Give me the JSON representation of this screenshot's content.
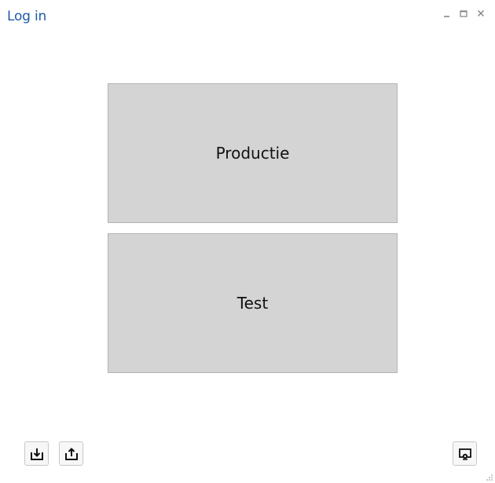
{
  "window": {
    "title": "Log in",
    "controls": {
      "minimize": "_",
      "maximize": "□",
      "close": "×"
    }
  },
  "environments": [
    {
      "label": "Productie"
    },
    {
      "label": "Test"
    }
  ],
  "toolbar": {
    "import_icon": "import-tray-icon",
    "export_icon": "export-tray-icon",
    "config_icon": "screen-settings-icon"
  },
  "colors": {
    "title": "#1e5aa8",
    "env_button_bg": "#d4d4d4",
    "env_button_border": "#b4b4b4"
  }
}
